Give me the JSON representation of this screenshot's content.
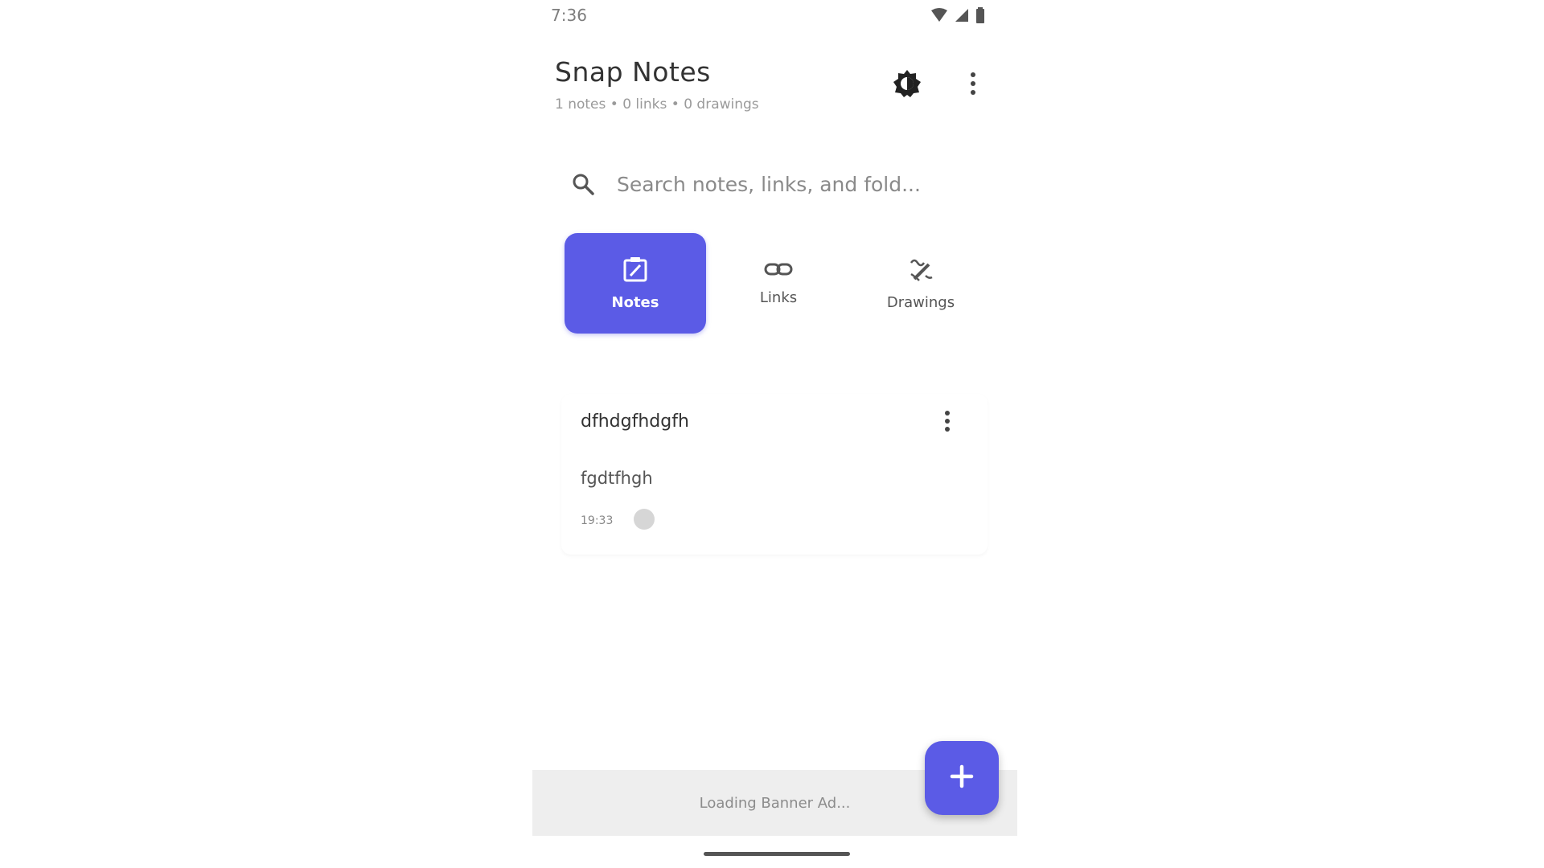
{
  "status_bar": {
    "time": "7:36",
    "icons": [
      "wifi-icon",
      "signal-icon",
      "battery-icon"
    ]
  },
  "app_bar": {
    "title": "Snap Notes",
    "subtitle": "1 notes • 0 links • 0 drawings",
    "actions": [
      "theme-toggle-icon",
      "more-vert-icon"
    ]
  },
  "search": {
    "placeholder": "Search notes, links, and fold..."
  },
  "tabs": [
    {
      "label": "Notes",
      "icon": "edit-note-icon",
      "active": true
    },
    {
      "label": "Links",
      "icon": "link-icon",
      "active": false
    },
    {
      "label": "Drawings",
      "icon": "draw-icon",
      "active": false
    }
  ],
  "notes": [
    {
      "title": "dfhdgfhdgfh",
      "body": "fgdtfhgh",
      "time": "19:33"
    }
  ],
  "ad_banner": {
    "text": "Loading Banner Ad..."
  },
  "fab": {
    "icon": "add-icon"
  },
  "colors": {
    "accent": "#5b5be6",
    "text_primary": "#333333",
    "text_secondary": "#9a9a9a",
    "ad_background": "#eeeeee"
  }
}
